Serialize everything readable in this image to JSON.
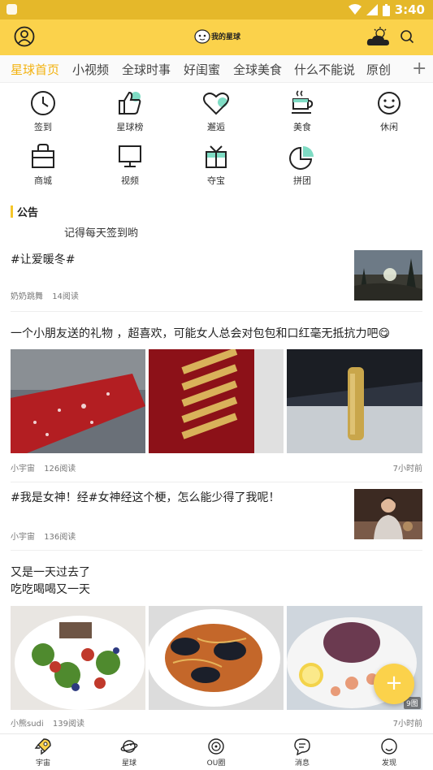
{
  "status_bar": {
    "time": "3:40"
  },
  "header": {
    "logo_text": "我的星球"
  },
  "tabs": [
    {
      "label": "星球首页",
      "active": true
    },
    {
      "label": "小视频"
    },
    {
      "label": "全球时事"
    },
    {
      "label": "好闺蜜"
    },
    {
      "label": "全球美食"
    },
    {
      "label": "什么不能说"
    },
    {
      "label": "原创"
    }
  ],
  "tabs_more": "+",
  "grid": [
    {
      "label": "签到",
      "icon": "clock-icon"
    },
    {
      "label": "星球榜",
      "icon": "thumbs-up-icon"
    },
    {
      "label": "邂逅",
      "icon": "heart-icon"
    },
    {
      "label": "美食",
      "icon": "coffee-cup-icon"
    },
    {
      "label": "休闲",
      "icon": "smiley-icon"
    },
    {
      "label": "商城",
      "icon": "shopping-bag-icon"
    },
    {
      "label": "视频",
      "icon": "monitor-icon"
    },
    {
      "label": "夺宝",
      "icon": "gift-box-icon"
    },
    {
      "label": "拼团",
      "icon": "pie-chart-icon"
    }
  ],
  "notice": {
    "title": "公告",
    "text": "记得每天签到哟"
  },
  "posts": [
    {
      "title": "#让爱暖冬#",
      "author": "奶奶跳舞",
      "reads": "14阅读",
      "time": ""
    },
    {
      "title": "一个小朋友送的礼物    ，超喜欢，可能女人总会对包包和口红毫无抵抗力吧😋",
      "author": "小宇宙",
      "reads": "126阅读",
      "time": "7小时前"
    },
    {
      "title": "#我是女神！经#女神经这个梗，怎么能少得了我呢！",
      "author": "小宇宙",
      "reads": "136阅读",
      "time": ""
    },
    {
      "title_line1": "又是一天过去了",
      "title_line2": "吃吃喝喝又一天",
      "author": "小熊sudi",
      "reads": "139阅读",
      "time": "7小时前",
      "image_count": "9图"
    }
  ],
  "fab": "+",
  "bottom_nav": [
    {
      "label": "宇宙",
      "icon": "rocket-icon",
      "active": true
    },
    {
      "label": "星球",
      "icon": "planet-icon"
    },
    {
      "label": "OU圈",
      "icon": "ou-circle-icon"
    },
    {
      "label": "消息",
      "icon": "message-icon"
    },
    {
      "label": "发现",
      "icon": "discover-icon"
    }
  ],
  "colors": {
    "accent": "#fbd24b",
    "status_bar": "#e5b82a",
    "active_tab": "#f3b20f",
    "icon_accent": "#7fdcc4"
  }
}
